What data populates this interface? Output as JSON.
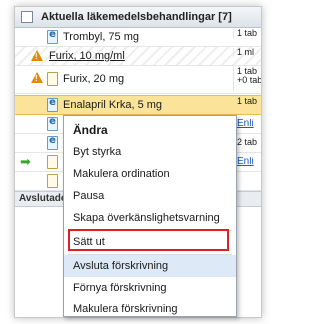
{
  "panel": {
    "title": "Aktuella läkemedelsbehandlingar [7]",
    "section_label": "Avslutade"
  },
  "rows": [
    {
      "name": "Trombyl, 75 mg",
      "dose": "1 tab"
    },
    {
      "name": "Furix, 10 mg/ml",
      "dose": "1 ml"
    },
    {
      "name": "Furix, 20 mg",
      "dose": "1 tab +0 tab"
    },
    {
      "name": "Enalapril Krka, 5 mg",
      "dose": "1 tab"
    },
    {
      "name": "",
      "dose": "Enli"
    },
    {
      "name": "",
      "dose": "2 tab"
    },
    {
      "name": "",
      "dose": "Enli"
    }
  ],
  "menu": {
    "items": [
      "Ändra",
      "Byt styrka",
      "Makulera ordination",
      "Pausa",
      "Skapa överkänslighetsvarning",
      "Sätt ut",
      "Avsluta förskrivning",
      "Förnya förskrivning",
      "Makulera förskrivning"
    ]
  },
  "colors": {
    "selected_row": "#fbe49a",
    "highlight_box": "#e01f25",
    "menu_hover": "#dde9f7",
    "warning": "#e58a00",
    "arrow": "#3aa52c",
    "link": "#1d59c7"
  },
  "icons": {
    "row_document": "document-icon",
    "row_e_document": "e-prescription-icon",
    "row_warning": "warning-icon",
    "row_arrow": "green-arrow-icon"
  }
}
